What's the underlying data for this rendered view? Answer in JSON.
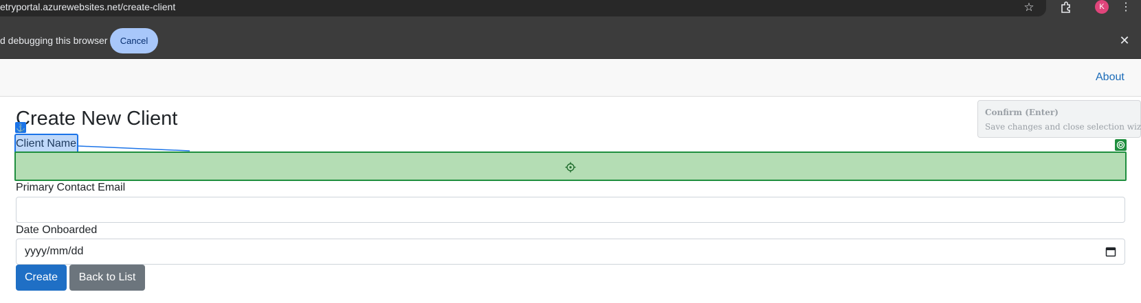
{
  "browser": {
    "url": "etryportal.azurewebsites.net/create-client",
    "avatar_initial": "K"
  },
  "infobar": {
    "message": "d debugging this browser",
    "cancel_label": "Cancel",
    "close_glyph": "✕"
  },
  "nav": {
    "about_label": "About"
  },
  "form": {
    "title": "Create New Client",
    "client_name_label": "Client Name",
    "client_name_value": "",
    "email_label": "Primary Contact Email",
    "email_value": "",
    "date_label": "Date Onboarded",
    "date_placeholder": "yyyy/mm/dd",
    "create_label": "Create",
    "back_label": "Back to List"
  },
  "wizard": {
    "confirm_title": "Confirm (Enter)",
    "confirm_desc": "Save changes and close selection wizard.",
    "anchor_color": "#1a73e8",
    "target_color": "#1e8e3e"
  }
}
